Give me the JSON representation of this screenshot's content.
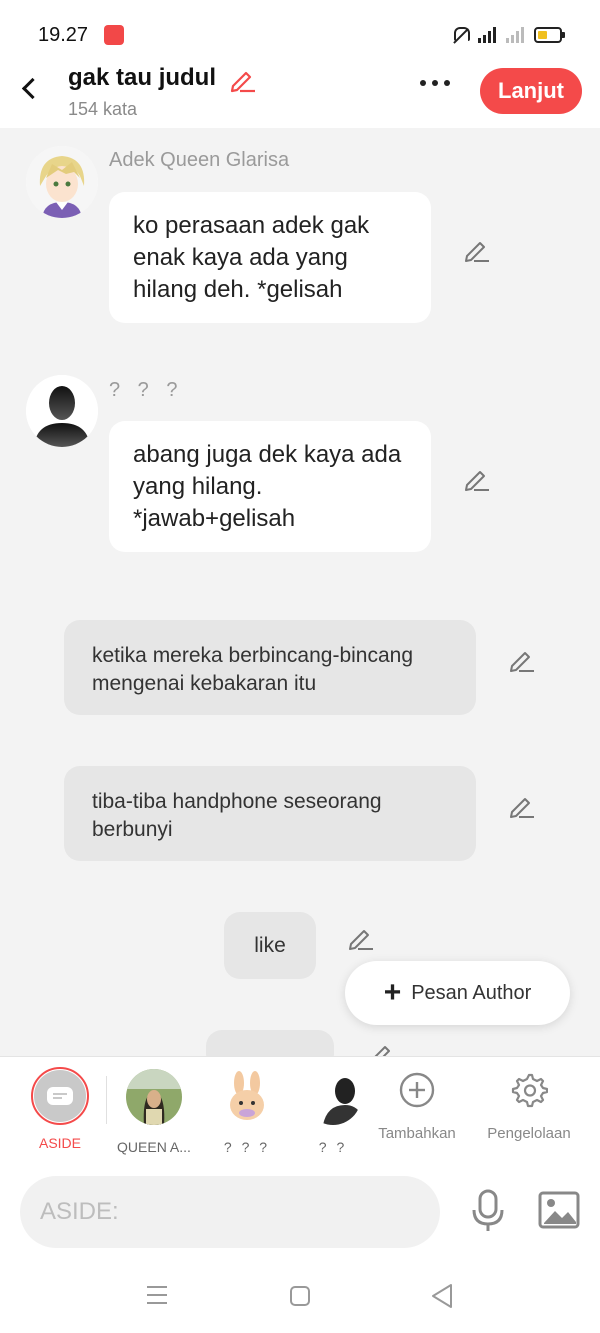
{
  "status_bar": {
    "time": "19.27"
  },
  "header": {
    "title": "gak tau judul",
    "word_count": "154 kata",
    "continue_label": "Lanjut"
  },
  "chat": {
    "messages": [
      {
        "speaker": "Adek Queen Glarisa",
        "text": "ko perasaan adek gak enak kaya ada yang hilang deh. *gelisah"
      },
      {
        "speaker": "? ? ?",
        "text": "abang juga dek kaya ada yang hilang. *jawab+gelisah"
      }
    ],
    "narrations": [
      "ketika mereka berbincang-bincang mengenai kebakaran itu",
      "tiba-tiba handphone seseorang berbunyi"
    ],
    "aside_like": "like",
    "author_message_label": "Pesan Author"
  },
  "characters": [
    {
      "label": "ASIDE"
    },
    {
      "label": "QUEEN A..."
    },
    {
      "label": "? ? ?"
    },
    {
      "label": "? ?"
    }
  ],
  "actions": {
    "add_label": "Tambahkan",
    "manage_label": "Pengelolaan"
  },
  "composer": {
    "placeholder": "ASIDE:"
  },
  "colors": {
    "accent": "#f44a4a",
    "background": "#f3f3f3",
    "narration_bg": "#e6e6e6"
  }
}
